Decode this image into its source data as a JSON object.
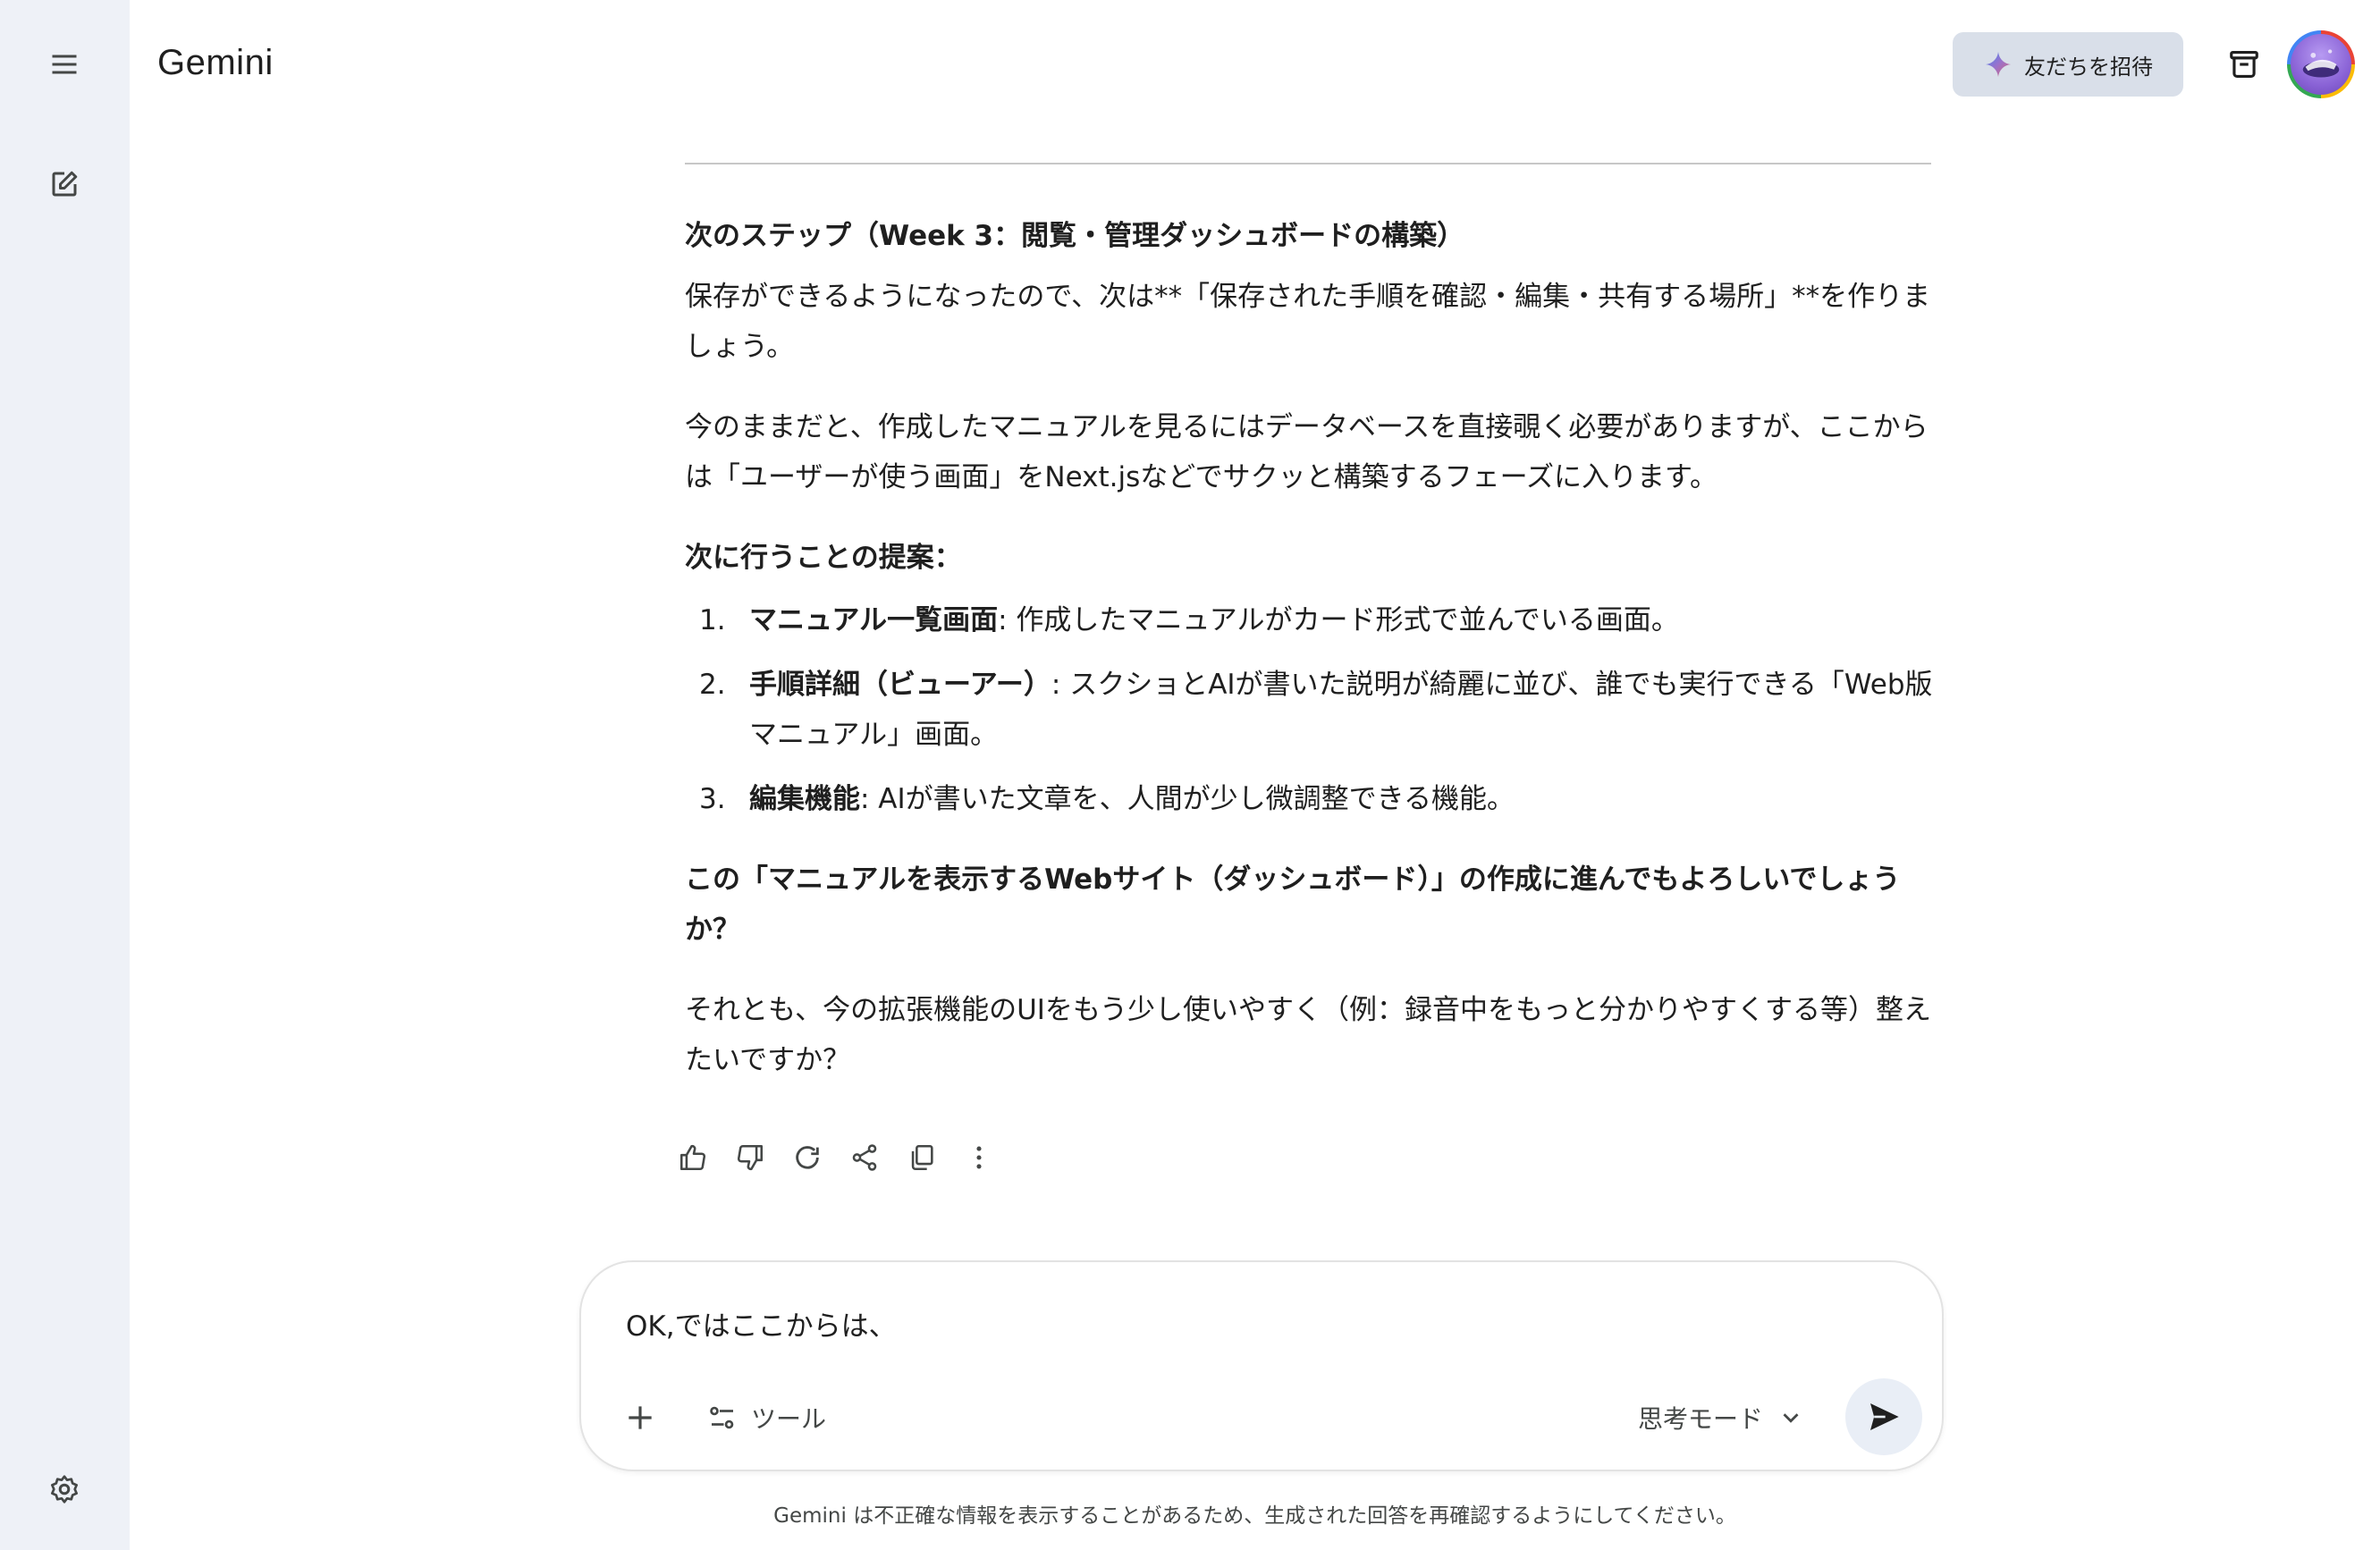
{
  "app": {
    "title": "Gemini"
  },
  "sidebar": {
    "menu_icon": "menu-icon",
    "new_chat_icon": "edit-icon",
    "settings_icon": "settings-gear-icon"
  },
  "header": {
    "invite_label": "友だちを招待",
    "invite_icon": "gemini-sparkle-icon",
    "temp_chat_icon": "temporary-chat-icon"
  },
  "response": {
    "heading": "次のステップ（Week 3：閲覧・管理ダッシュボードの構築）",
    "para1": "保存ができるようになったので、次は**「保存された手順を確認・編集・共有する場所」**を作りましょう。",
    "para2": "今のままだと、作成したマニュアルを見るにはデータベースを直接覗く必要がありますが、ここからは「ユーザーが使う画面」をNext.jsなどでサクッと構築するフェーズに入ります。",
    "proposal_heading": "次に行うことの提案：",
    "items": [
      {
        "num": "1.",
        "title": "マニュアル一覧画面",
        "text": ": 作成したマニュアルがカード形式で並んでいる画面。"
      },
      {
        "num": "2.",
        "title": "手順詳細（ビューアー）",
        "text": ": スクショとAIが書いた説明が綺麗に並び、誰でも実行できる「Web版マニュアル」画面。"
      },
      {
        "num": "3.",
        "title": "編集機能",
        "text": ": AIが書いた文章を、人間が少し微調整できる機能。"
      }
    ],
    "question": "この「マニュアルを表示するWebサイト（ダッシュボード）」の作成に進んでもよろしいでしょうか？",
    "para3": "それとも、今の拡張機能のUIをもう少し使いやすく（例：録音中をもっと分かりやすくする等）整えたいですか？"
  },
  "actions": [
    "thumbs-up-icon",
    "thumbs-down-icon",
    "regenerate-icon",
    "share-icon",
    "copy-icon",
    "more-vert-icon"
  ],
  "composer": {
    "value": "OK,ではここからは、",
    "tools_label": "ツール",
    "mode_label": "思考モード"
  },
  "disclaimer": "Gemini は不正確な情報を表示することがあるため、生成された回答を再確認するようにしてください。"
}
